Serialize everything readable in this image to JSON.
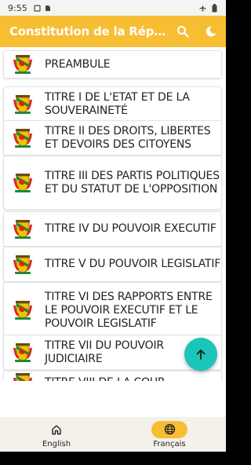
{
  "status": {
    "time": "9:55"
  },
  "appbar": {
    "title": "Constitution de la République du Congo",
    "search_icon": "search-icon",
    "theme_icon": "dark-mode-icon"
  },
  "list": {
    "items": [
      {
        "label": "PREAMBULE"
      },
      {
        "label": "TITRE  I DE L'ETAT ET DE LA SOUVERAINETÉ"
      },
      {
        "label": "TITRE II DES DROITS, LIBERTES ET DEVOIRS DES CITOYENS"
      },
      {
        "label": "TITRE III DES PARTIS POLITIQUES ET DU STATUT DE L'OPPOSITION"
      },
      {
        "label": "TITRE IV DU POUVOIR EXECUTIF"
      },
      {
        "label": "TITRE V DU POUVOIR LEGISLATIF"
      },
      {
        "label": "TITRE VI DES RAPPORTS ENTRE LE POUVOIR EXECUTIF ET LE POUVOIR LEGISLATIF"
      },
      {
        "label": "TITRE VII DU POUVOIR JUDICIAIRE"
      },
      {
        "label": "TITRE VIII DE LA COUR"
      }
    ]
  },
  "fab": {
    "icon": "arrow-up-icon"
  },
  "bottom_nav": {
    "items": [
      {
        "label": "English",
        "icon": "home-icon",
        "active": false
      },
      {
        "label": "Français",
        "icon": "globe-icon",
        "active": true
      }
    ]
  },
  "colors": {
    "accent": "#f7bd33",
    "fab": "#1bc5b9"
  }
}
